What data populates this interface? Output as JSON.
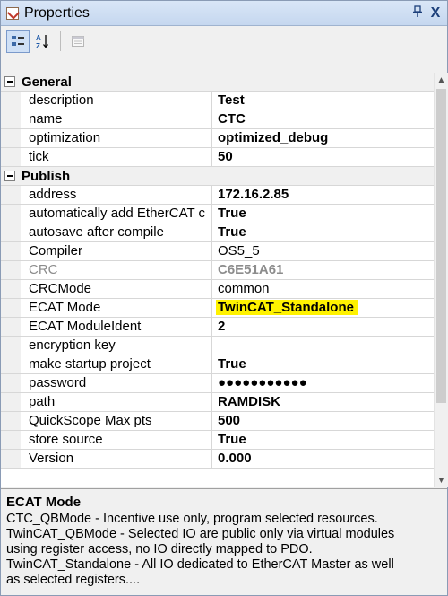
{
  "window": {
    "title": "Properties",
    "pin_glyph": "p",
    "close_glyph": "X"
  },
  "toolbar": {
    "categorized_icon": "categorized-icon",
    "alphabetical_icon": "sort-alphabetical-icon",
    "property_pages_icon": "property-pages-icon"
  },
  "grid": {
    "categories": [
      {
        "name": "General",
        "rows": [
          {
            "name": "description",
            "value": "Test"
          },
          {
            "name": "name",
            "value": "CTC"
          },
          {
            "name": "optimization",
            "value": "optimized_debug"
          },
          {
            "name": "tick",
            "value": "50"
          }
        ]
      },
      {
        "name": "Publish",
        "rows": [
          {
            "name": "address",
            "value": "172.16.2.85"
          },
          {
            "name": "automatically add EtherCAT c",
            "value": "True"
          },
          {
            "name": "autosave after compile",
            "value": "True"
          },
          {
            "name": "Compiler",
            "value": "OS5_5"
          },
          {
            "name": "CRC",
            "value": "C6E51A61"
          },
          {
            "name": "CRCMode",
            "value": "common"
          },
          {
            "name": "ECAT Mode",
            "value": "TwinCAT_Standalone"
          },
          {
            "name": "ECAT ModuleIdent",
            "value": "2"
          },
          {
            "name": "encryption key",
            "value": ""
          },
          {
            "name": "make startup project",
            "value": "True"
          },
          {
            "name": "password",
            "value": "●●●●●●●●●●●"
          },
          {
            "name": "path",
            "value": "RAMDISK"
          },
          {
            "name": "QuickScope Max pts",
            "value": "500"
          },
          {
            "name": "store source",
            "value": "True"
          },
          {
            "name": "Version",
            "value": "0.000"
          }
        ]
      }
    ]
  },
  "description": {
    "title": "ECAT Mode",
    "lines": [
      "CTC_QBMode - Incentive use only, program selected resources.",
      "TwinCAT_QBMode - Selected IO are public only via virtual modules",
      "using register access, no IO directly mapped to PDO.",
      "TwinCAT_Standalone - All IO dedicated to EtherCAT Master as well",
      "as selected registers...."
    ]
  },
  "colors": {
    "highlight": "#fff200",
    "titlebar": "#c5d7ef",
    "disabled_text": "#8c8c8c"
  }
}
